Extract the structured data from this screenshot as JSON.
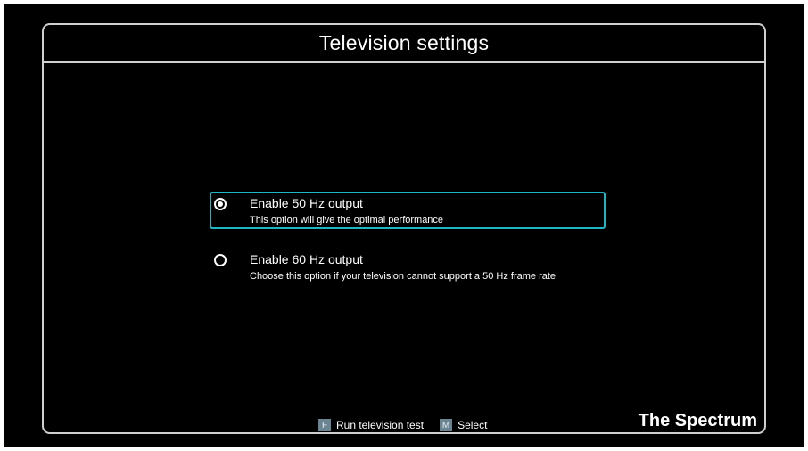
{
  "header": {
    "title": "Television settings"
  },
  "options": [
    {
      "label": "Enable 50 Hz output",
      "description": "This option will give the optimal performance",
      "checked": true
    },
    {
      "label": "Enable 60 Hz output",
      "description": "Choose this option if your television cannot support a 50 Hz frame rate",
      "checked": false
    }
  ],
  "footer": {
    "hints": [
      {
        "key": "F",
        "label": "Run television test"
      },
      {
        "key": "M",
        "label": "Select"
      }
    ],
    "brand": "The Spectrum"
  },
  "colors": {
    "background": "#000000",
    "frame_border": "#cfcfcf",
    "selection_border": "#1fb6c4",
    "key_badge": "#6a8492",
    "text": "#ffffff"
  },
  "icons": {
    "radio_checked": "radio-checked-icon",
    "radio_unchecked": "radio-unchecked-icon"
  }
}
